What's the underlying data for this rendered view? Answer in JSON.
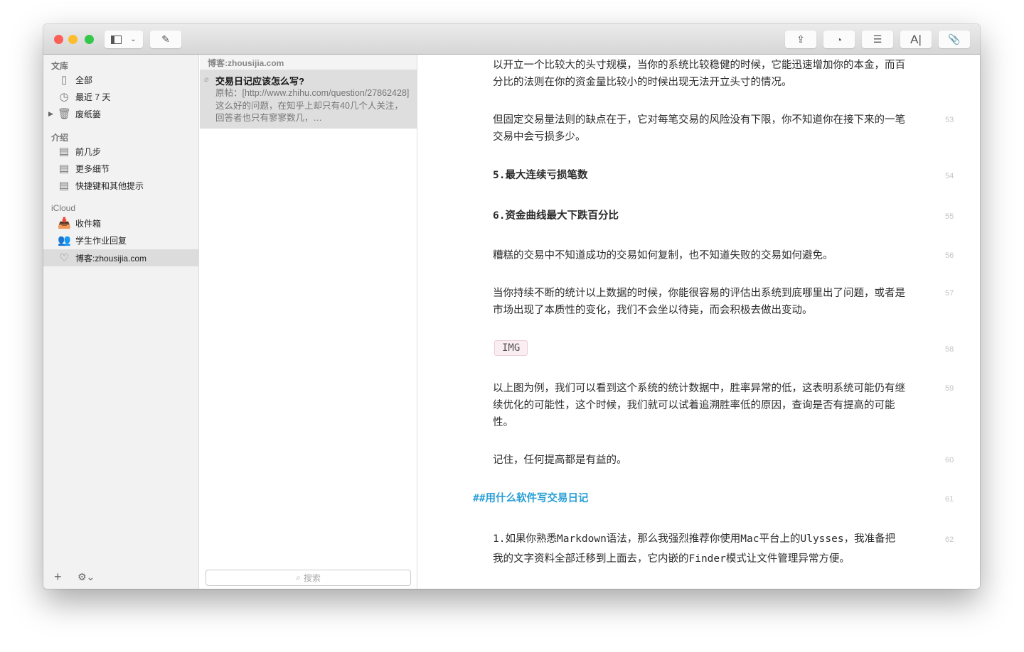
{
  "sidebar": {
    "sections": [
      {
        "title": "文库",
        "items": [
          {
            "label": "全部",
            "icon": "notebooks-icon"
          },
          {
            "label": "最近 7 天",
            "icon": "clock-icon"
          },
          {
            "label": "废纸篓",
            "icon": "trash-icon"
          }
        ]
      },
      {
        "title": "介绍",
        "items": [
          {
            "label": "前几步",
            "icon": "document-icon"
          },
          {
            "label": "更多细节",
            "icon": "document-icon"
          },
          {
            "label": "快捷键和其他提示",
            "icon": "document-icon"
          }
        ]
      },
      {
        "title": "iCloud",
        "items": [
          {
            "label": "收件箱",
            "icon": "inbox-icon"
          },
          {
            "label": "学生作业回复",
            "icon": "people-icon"
          },
          {
            "label": "博客:zhousijia.com",
            "icon": "heart-icon"
          }
        ]
      }
    ],
    "add": "+",
    "gear": "⚙⌄"
  },
  "list": {
    "header": "博客:zhousijia.com",
    "notes": [
      {
        "title": "交易日记应该怎么写?",
        "preview": "原帖：[http://www.zhihu.com/question/27862428] 这么好的问题，在知乎上却只有40几个人关注，回答者也只有寥寥数几，…"
      }
    ],
    "search_placeholder": "搜索"
  },
  "editor": {
    "paragraphs": [
      {
        "text": "以开立一个比较大的头寸规模，当你的系统比较稳健的时候，它能迅速增加你的本金，而百分比的法则在你的资金量比较小的时候出现无法开立头寸的情况。",
        "line": ""
      },
      {
        "text": "但固定交易量法则的缺点在于，它对每笔交易的风险没有下限，你不知道你在接下来的一笔交易中会亏损多少。",
        "line": "53"
      },
      {
        "text": "5.最大连续亏损笔数",
        "line": "54"
      },
      {
        "text": "6.资金曲线最大下跌百分比",
        "line": "55"
      },
      {
        "text": "糟糕的交易中不知道成功的交易如何复制，也不知道失败的交易如何避免。",
        "line": "56"
      },
      {
        "text": "当你持续不断的统计以上数据的时候，你能很容易的评估出系统到底哪里出了问题，或者是市场出现了本质性的变化，我们不会坐以待毙，而会积极去做出变动。",
        "line": "57"
      },
      {
        "text": "IMG",
        "line": "58"
      },
      {
        "text": "以上图为例，我们可以看到这个系统的统计数据中，胜率异常的低，这表明系统可能仍有继续优化的可能性，这个时候，我们就可以试着追溯胜率低的原因，查询是否有提高的可能性。",
        "line": "59"
      },
      {
        "text": "记住，任何提高都是有益的。",
        "line": "60"
      },
      {
        "text": "##用什么软件写交易日记",
        "line": "61"
      },
      {
        "text": "1.如果你熟悉Markdown语法，那么我强烈推荐你使用Mac平台上的Ulysses，我准备把我的文字资料全部迁移到上面去，它内嵌的Finder模式让文件管理异常方便。",
        "line": "62"
      }
    ]
  },
  "colors": {
    "heading": "#2a9fd6",
    "close": "#fc5f57",
    "minimize": "#fdbc2e",
    "zoom": "#34c84a"
  }
}
